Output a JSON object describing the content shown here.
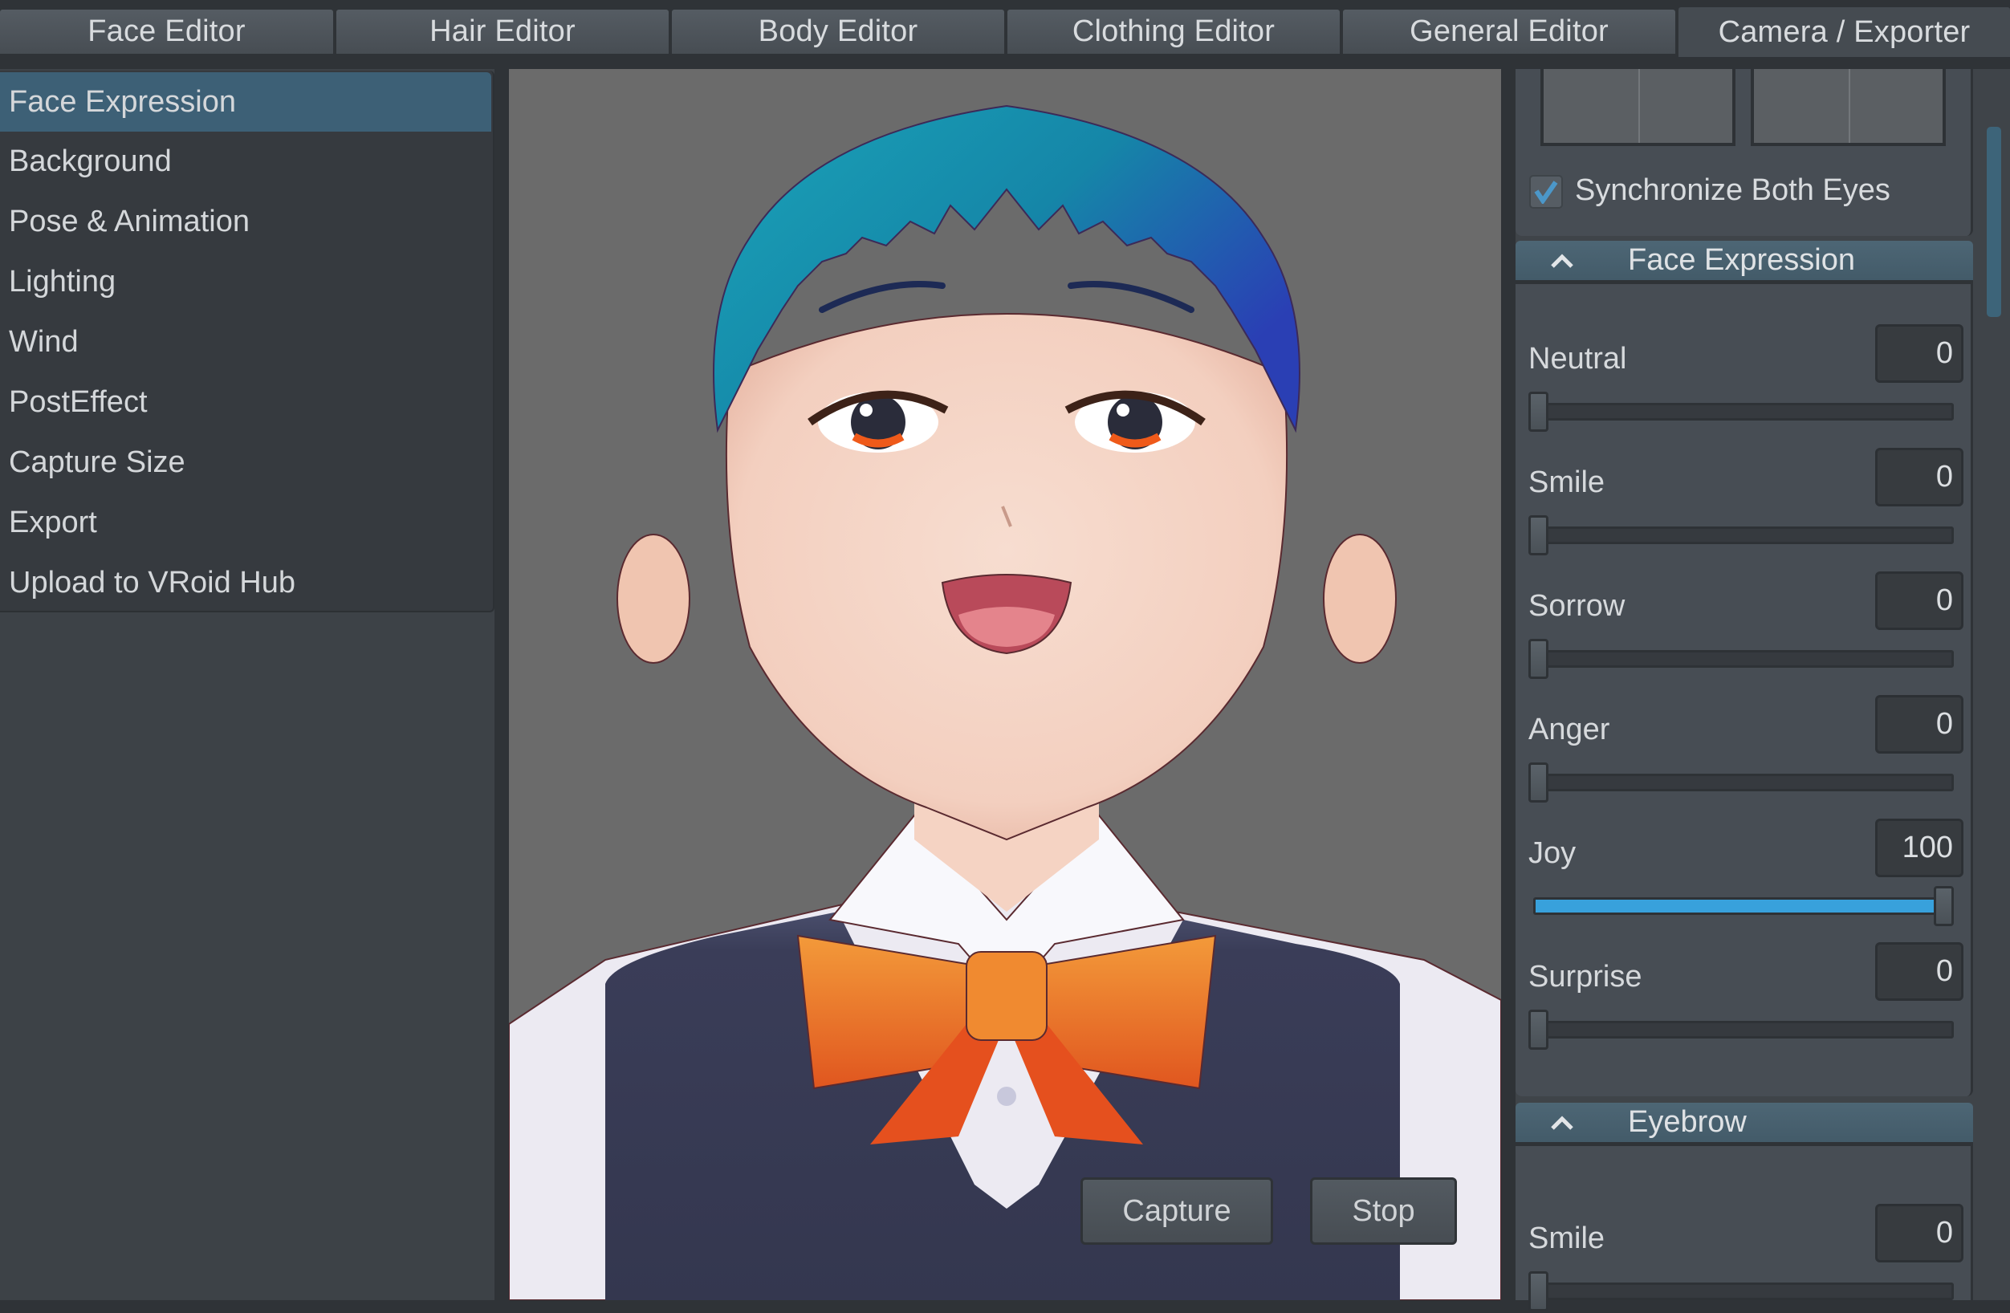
{
  "tabs": [
    {
      "label": "Face Editor",
      "active": false
    },
    {
      "label": "Hair Editor",
      "active": false
    },
    {
      "label": "Body Editor",
      "active": false
    },
    {
      "label": "Clothing Editor",
      "active": false
    },
    {
      "label": "General Editor",
      "active": false
    },
    {
      "label": "Camera / Exporter",
      "active": true
    }
  ],
  "sidebar": {
    "items": [
      {
        "label": "Face Expression",
        "active": true
      },
      {
        "label": "Background",
        "active": false
      },
      {
        "label": "Pose & Animation",
        "active": false
      },
      {
        "label": "Lighting",
        "active": false
      },
      {
        "label": "Wind",
        "active": false
      },
      {
        "label": "PostEffect",
        "active": false
      },
      {
        "label": "Capture Size",
        "active": false
      },
      {
        "label": "Export",
        "active": false
      },
      {
        "label": "Upload to VRoid Hub",
        "active": false
      }
    ]
  },
  "viewport": {
    "capture_label": "Capture",
    "stop_label": "Stop",
    "background_color": "#6b6b6b"
  },
  "right_panel": {
    "sync_eyes": {
      "label": "Synchronize Both Eyes",
      "checked": true
    },
    "face_expression": {
      "title": "Face Expression",
      "expanded": true,
      "params": [
        {
          "label": "Neutral",
          "value": "0",
          "fraction": 0
        },
        {
          "label": "Smile",
          "value": "0",
          "fraction": 0
        },
        {
          "label": "Sorrow",
          "value": "0",
          "fraction": 0
        },
        {
          "label": "Anger",
          "value": "0",
          "fraction": 0
        },
        {
          "label": "Joy",
          "value": "100",
          "fraction": 1
        },
        {
          "label": "Surprise",
          "value": "0",
          "fraction": 0
        }
      ]
    },
    "eyebrow": {
      "title": "Eyebrow",
      "expanded": true,
      "params": [
        {
          "label": "Smile",
          "value": "0",
          "fraction": 0
        }
      ]
    }
  },
  "colors": {
    "accent": "#38a1dc",
    "selected": "#3d6076",
    "section_header": "#4a6270",
    "panel": "#474d54",
    "background": "#2f3337"
  }
}
